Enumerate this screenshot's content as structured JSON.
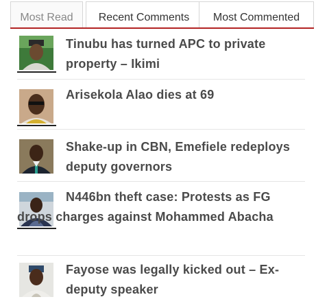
{
  "tabs": [
    {
      "label": "Most Read",
      "active": true
    },
    {
      "label": "Recent Comments",
      "active": false
    },
    {
      "label": "Most Commented",
      "active": false
    }
  ],
  "accent_color": "#b22222",
  "articles": [
    {
      "title": "Tinubu has turned APC to private property – Ikimi",
      "thumbnail": "portrait-man-cap"
    },
    {
      "title": "Arisekola Alao dies at 69",
      "thumbnail": "portrait-man-glasses"
    },
    {
      "title": "Shake-up in CBN, Emefiele redeploys deputy governors",
      "thumbnail": "portrait-man-suit"
    },
    {
      "title": "N446bn theft case: Protests as FG drops charges against Mohammed Abacha",
      "thumbnail": "portrait-man-robe"
    },
    {
      "title": "Fayose was legally kicked out – Ex-deputy speaker",
      "thumbnail": "portrait-man-cap-2"
    }
  ]
}
